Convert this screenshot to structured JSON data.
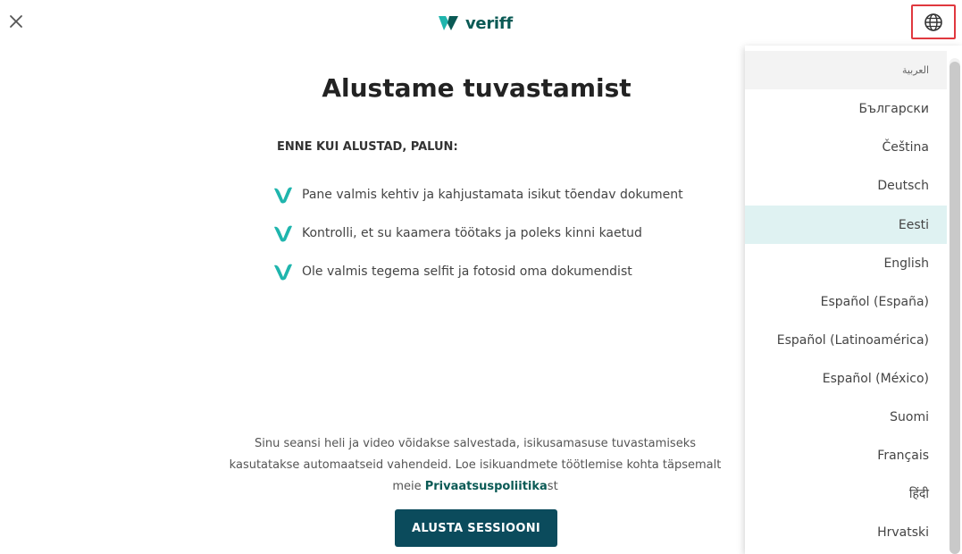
{
  "header": {
    "logo_text": "veriff",
    "close_icon": "close-icon",
    "language_icon": "globe-icon",
    "brand_color": "#0a5a55",
    "language_button_border": "#e0383e"
  },
  "main": {
    "title": "Alustame tuvastamist",
    "preparation_heading": "ENNE KUI ALUSTAD, PALUN:",
    "checklist": [
      "Pane valmis kehtiv ja kahjustamata isikut tõendav dokument",
      "Kontrolli, et su kaamera töötaks ja poleks kinni kaetud",
      "Ole valmis tegema selfit ja fotosid oma dokumendist"
    ],
    "check_color": "#1fb5ad",
    "disclaimer_line1": "Sinu seansi heli ja video võidakse salvestada, isikusamasuse tuvastamiseks",
    "disclaimer_line2": "kasutatakse automaatseid vahendeid. Loe isikuandmete töötlemise kohta täpsemalt",
    "disclaimer_prefix": "meie ",
    "privacy_link": "Privaatsuspoliitika",
    "disclaimer_suffix": "st",
    "start_button": "ALUSTA SESSIOONI",
    "start_button_color": "#0b4b5c"
  },
  "language_menu": {
    "selected": "Eesti",
    "items": [
      "العربية",
      "Български",
      "Čeština",
      "Deutsch",
      "Eesti",
      "English",
      "Español (España)",
      "Español (Latinoamérica)",
      "Español (México)",
      "Suomi",
      "Français",
      "हिंदी",
      "Hrvatski"
    ],
    "selected_bg": "#dff2f2"
  }
}
